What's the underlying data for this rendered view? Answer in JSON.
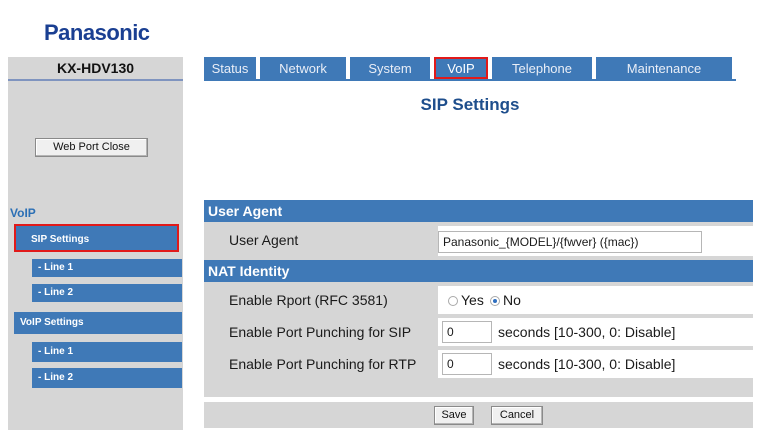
{
  "brand": {
    "logo": "Panasonic",
    "model": "KX-HDV130"
  },
  "tabs": [
    {
      "label": "Status"
    },
    {
      "label": "Network"
    },
    {
      "label": "System"
    },
    {
      "label": "VoIP"
    },
    {
      "label": "Telephone"
    },
    {
      "label": "Maintenance"
    }
  ],
  "active_tab": "VoIP",
  "page": {
    "title": "SIP Settings"
  },
  "sidebar": {
    "web_port_close": "Web Port Close",
    "section_title": "VoIP",
    "items": [
      {
        "label": "SIP Settings"
      },
      {
        "label": "- Line 1"
      },
      {
        "label": "- Line 2"
      },
      {
        "label": "VoIP Settings"
      },
      {
        "label": "- Line 1"
      },
      {
        "label": "- Line 2"
      }
    ]
  },
  "sections": {
    "user_agent": {
      "title": "User Agent",
      "label": "User Agent",
      "value": "Panasonic_{MODEL}/{fwver} ({mac})"
    },
    "nat": {
      "title": "NAT Identity",
      "rport_label": "Enable Rport (RFC 3581)",
      "rport_yes": "Yes",
      "rport_no": "No",
      "rport_selected": "No",
      "sip_label": "Enable Port Punching for SIP",
      "sip_value": "0",
      "rtp_label": "Enable Port Punching for RTP",
      "rtp_value": "0",
      "seconds_hint": "seconds [10-300, 0: Disable]"
    }
  },
  "actions": {
    "save": "Save",
    "cancel": "Cancel"
  },
  "colors": {
    "brand": "#1a3f92",
    "accent": "#3f79b7",
    "panel": "#d6d6d6",
    "highlight": "#e11a1a"
  }
}
